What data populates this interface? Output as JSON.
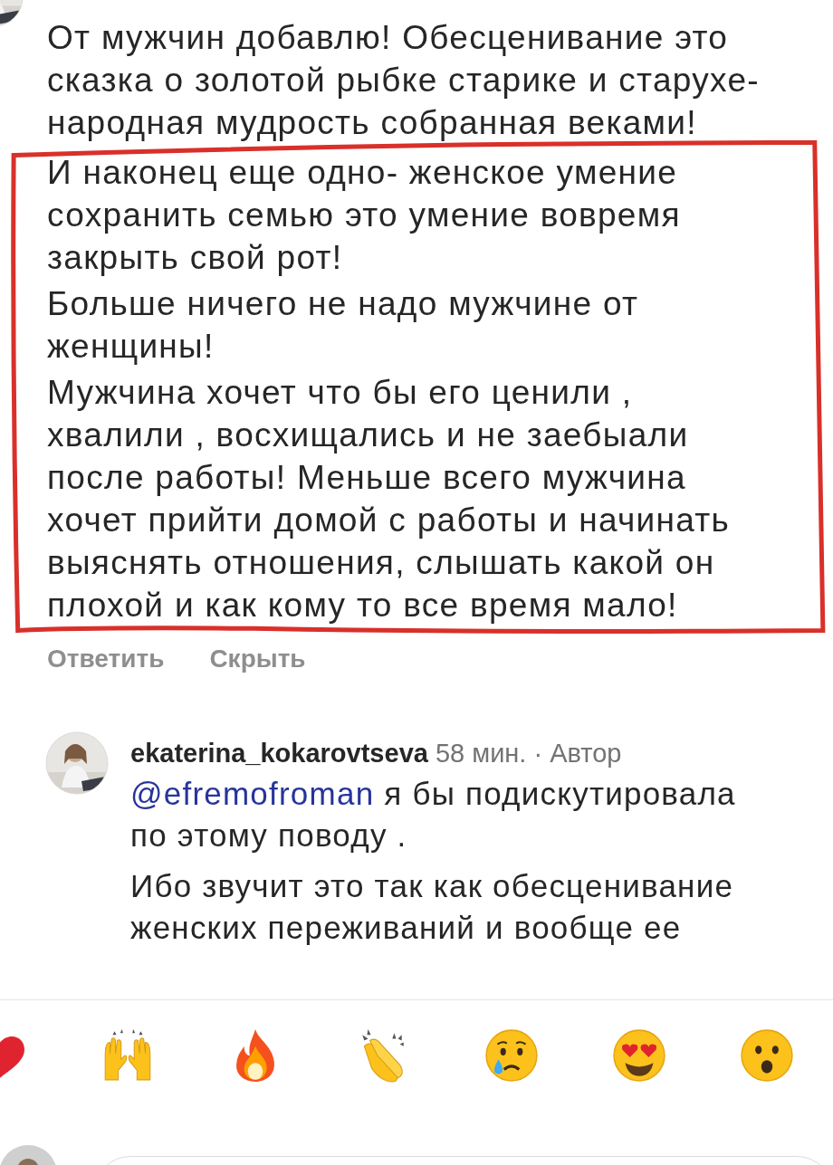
{
  "comment": {
    "paragraphs": [
      {
        "text": "От мужчин добавлю! Обесценивание это сказка о золотой рыбке старике и старухе- народная мудрость собранная веками!",
        "highlighted": false
      },
      {
        "text": "И наконец еще одно- женское умение сохранить семью это умение вовремя закрыть свой рот!",
        "highlighted": true
      },
      {
        "text": "Больше ничего не надо мужчине от женщины!",
        "highlighted": true
      },
      {
        "text": "Мужчина хочет что бы его ценили , хвалили , восхищались и не заебыали после работы! Меньше всего мужчина хочет прийти домой с работы и начинать выяснять отношения, слышать какой он плохой и как кому то все время мало!",
        "highlighted": true
      }
    ]
  },
  "actions": [
    {
      "label": "Ответить"
    },
    {
      "label": "Скрыть"
    }
  ],
  "reply": {
    "username": "ekaterina_kokarovtseva",
    "time": "58 мин.",
    "role": "· Автор",
    "mention": "@efremofroman",
    "paragraphs": [
      "я бы подискутировала по этому поводу .",
      "Ибо звучит это так как обесценивание женских переживаний и вообще ее"
    ]
  },
  "reactions": [
    {
      "kind": "heart"
    },
    {
      "kind": "raised-hands"
    },
    {
      "kind": "fire"
    },
    {
      "kind": "clap"
    },
    {
      "kind": "crying"
    },
    {
      "kind": "heart-eyes"
    },
    {
      "kind": "surprised"
    }
  ]
}
